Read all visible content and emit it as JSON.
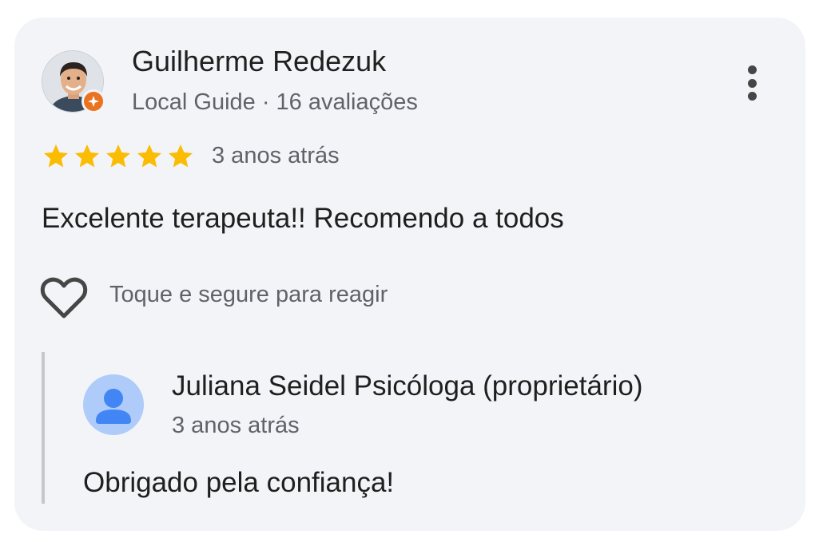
{
  "review": {
    "author_name": "Guilherme Redezuk",
    "author_meta": "Local Guide · 16 avaliações",
    "avatar_icon": "person-photo-icon",
    "badge_icon": "local-guide-badge-icon",
    "rating": 5,
    "rating_max": 5,
    "time": "3 anos atrás",
    "text": "Excelente terapeuta!! Recomendo a todos",
    "more_icon": "more-vert-icon",
    "react_icon": "heart-outline-icon",
    "react_hint": "Toque e segure para reagir"
  },
  "owner_reply": {
    "author_name": "Juliana Seidel Psicóloga (proprietário)",
    "avatar_icon": "default-person-icon",
    "time": "3 anos atrás",
    "text": "Obrigado pela confiança!"
  },
  "colors": {
    "card_background": "#f3f4f7",
    "star": "#fbbc04",
    "badge": "#e9731f",
    "owner_avatar_bg": "#aecbfa",
    "owner_avatar_fg": "#4285f4"
  }
}
